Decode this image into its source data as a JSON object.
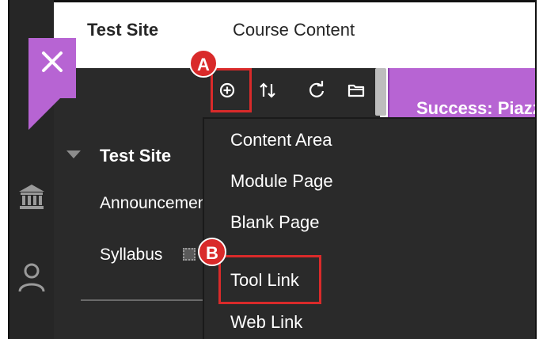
{
  "header": {
    "site_title": "Test Site",
    "page_title": "Course Content"
  },
  "toolbar": {
    "icons": [
      "add-menu-item-icon",
      "reorder-icon",
      "refresh-icon",
      "manage-folder-icon"
    ]
  },
  "course_menu": {
    "title": "Test Site",
    "items": [
      {
        "label": "Announcements"
      },
      {
        "label": "Syllabus"
      }
    ]
  },
  "banner": {
    "text": "Success: Piazza"
  },
  "dropdown": {
    "items": [
      {
        "label": "Content Area"
      },
      {
        "label": "Module Page"
      },
      {
        "label": "Blank Page"
      },
      {
        "label": "Tool Link"
      },
      {
        "label": "Web Link"
      }
    ]
  },
  "callouts": {
    "a": "A",
    "b": "B"
  },
  "colors": {
    "accent": "#b764d3",
    "panel": "#2a2a2a",
    "callout": "#d92a2a"
  }
}
